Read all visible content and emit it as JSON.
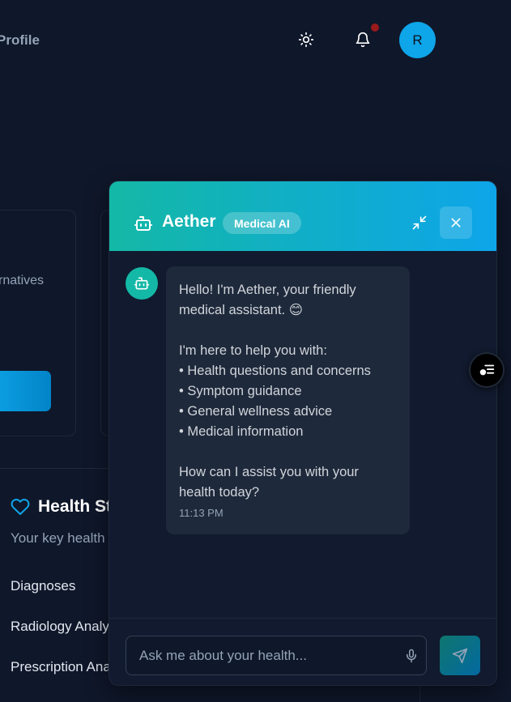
{
  "header": {
    "profile_link": "Profile",
    "avatar_initial": "R"
  },
  "background": {
    "alternatives_text": "rnatives",
    "health_title": "Health St",
    "health_subtitle": "Your key health",
    "rows": [
      "Diagnoses",
      "Radiology Analy",
      "Prescription Ana"
    ]
  },
  "chat": {
    "title": "Aether",
    "badge": "Medical AI",
    "message": {
      "lines": [
        "Hello! I'm Aether, your friendly",
        "medical assistant. 😊",
        "",
        "I'm here to help you with:",
        "• Health questions and concerns",
        "• Symptom guidance",
        "• General wellness advice",
        "• Medical information",
        "",
        "How can I assist you with your",
        "health today?"
      ],
      "time": "11:13 PM"
    },
    "input_placeholder": "Ask me about your health..."
  },
  "colors": {
    "accent_teal": "#14b8a6",
    "accent_blue": "#0ea5e9",
    "background": "#0f172a"
  },
  "icons": [
    "sun-icon",
    "bell-icon",
    "bot-icon",
    "minimize-icon",
    "close-icon",
    "heart-icon",
    "mic-icon",
    "send-icon",
    "list-chart-icon"
  ]
}
